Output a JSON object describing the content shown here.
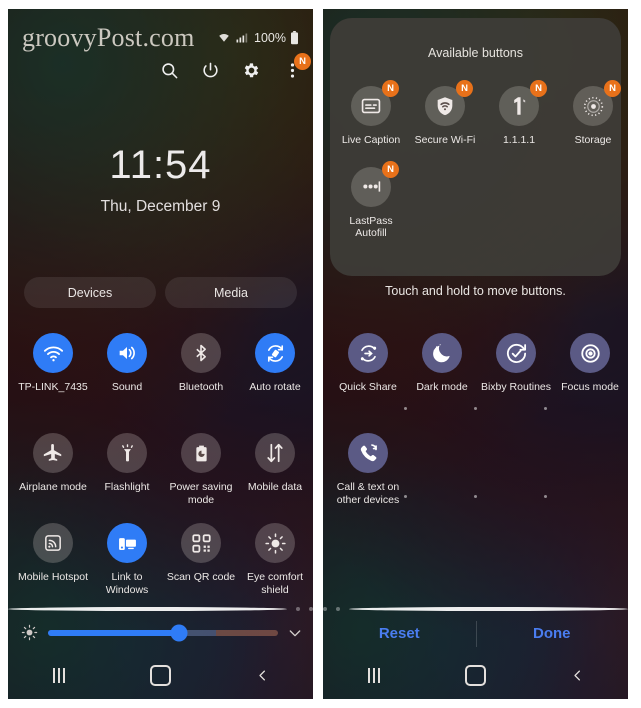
{
  "left_panel": {
    "brand_watermark": "groovyPost.com",
    "status_bar": {
      "wifi_icon": "wifi-icon",
      "signal_icon": "cellular-signal-icon",
      "battery_percent": "100%",
      "battery_icon": "battery-full-icon"
    },
    "header_icons": [
      {
        "name": "search-icon",
        "label": "Search"
      },
      {
        "name": "power-icon",
        "label": "Power off"
      },
      {
        "name": "gear-icon",
        "label": "Settings"
      },
      {
        "name": "more-options-icon",
        "label": "More options",
        "badge": "N"
      }
    ],
    "clock": {
      "time": "11:54",
      "date": "Thu, December 9"
    },
    "pills": [
      {
        "label": "Devices",
        "name": "devices-pill"
      },
      {
        "label": "Media",
        "name": "media-pill"
      }
    ],
    "tiles": [
      {
        "label": "TP-LINK_7435",
        "icon": "wifi-icon",
        "state": "on"
      },
      {
        "label": "Sound",
        "icon": "volume-icon",
        "state": "on"
      },
      {
        "label": "Bluetooth",
        "icon": "bluetooth-icon",
        "state": "off"
      },
      {
        "label": "Auto rotate",
        "icon": "auto-rotate-icon",
        "state": "on"
      },
      {
        "label": "Airplane mode",
        "icon": "airplane-icon",
        "state": "off"
      },
      {
        "label": "Flashlight",
        "icon": "flashlight-icon",
        "state": "off"
      },
      {
        "label": "Power saving mode",
        "icon": "battery-saver-icon",
        "state": "off"
      },
      {
        "label": "Mobile data",
        "icon": "mobile-data-icon",
        "state": "off"
      },
      {
        "label": "Mobile Hotspot",
        "icon": "hotspot-icon",
        "state": "off"
      },
      {
        "label": "Link to Windows",
        "icon": "link-to-windows-icon",
        "state": "on"
      },
      {
        "label": "Scan QR code",
        "icon": "qr-code-icon",
        "state": "off"
      },
      {
        "label": "Eye comfort shield",
        "icon": "eye-comfort-icon",
        "state": "off"
      }
    ],
    "page_dots": {
      "count": 3,
      "active_index": 0
    },
    "brightness": {
      "icon": "brightness-icon",
      "value_percent": 57,
      "expand_icon": "chevron-down-icon"
    },
    "nav_bar": [
      {
        "name": "recents-button",
        "icon": "recents-icon"
      },
      {
        "name": "home-button",
        "icon": "home-icon"
      },
      {
        "name": "back-button",
        "icon": "back-chevron-icon"
      }
    ]
  },
  "right_panel": {
    "available_title": "Available buttons",
    "available_tiles": [
      {
        "label": "Live Caption",
        "icon": "live-caption-icon",
        "badge": "N"
      },
      {
        "label": "Secure Wi-Fi",
        "icon": "secure-wifi-shield-icon",
        "badge": "N"
      },
      {
        "label": "1.1.1.1",
        "icon": "one-one-one-one-icon",
        "badge": "N"
      },
      {
        "label": "Storage",
        "icon": "storage-disk-icon",
        "badge": "N"
      },
      {
        "label": "LastPass Autofill",
        "icon": "lastpass-icon",
        "badge": "N"
      }
    ],
    "hint_text": "Touch and hold to move buttons.",
    "edit_tiles": [
      {
        "label": "Quick Share",
        "icon": "quick-share-icon"
      },
      {
        "label": "Dark mode",
        "icon": "moon-icon"
      },
      {
        "label": "Bixby Routines",
        "icon": "bixby-routines-icon"
      },
      {
        "label": "Focus mode",
        "icon": "focus-mode-icon"
      },
      {
        "label": "Call & text on other devices",
        "icon": "call-text-other-devices-icon"
      }
    ],
    "page_dots": {
      "count": 3,
      "active_index": 2
    },
    "actions": [
      {
        "label": "Reset",
        "name": "reset-button"
      },
      {
        "label": "Done",
        "name": "done-button"
      }
    ],
    "nav_bar": [
      {
        "name": "recents-button",
        "icon": "recents-icon"
      },
      {
        "name": "home-button",
        "icon": "home-icon"
      },
      {
        "name": "back-button",
        "icon": "back-chevron-icon"
      }
    ]
  },
  "colors": {
    "accent_blue": "#2f7cf6",
    "badge_orange": "#e8711a",
    "action_link_blue": "#4a7df0",
    "edit_tile_purple": "#5b5a85"
  }
}
